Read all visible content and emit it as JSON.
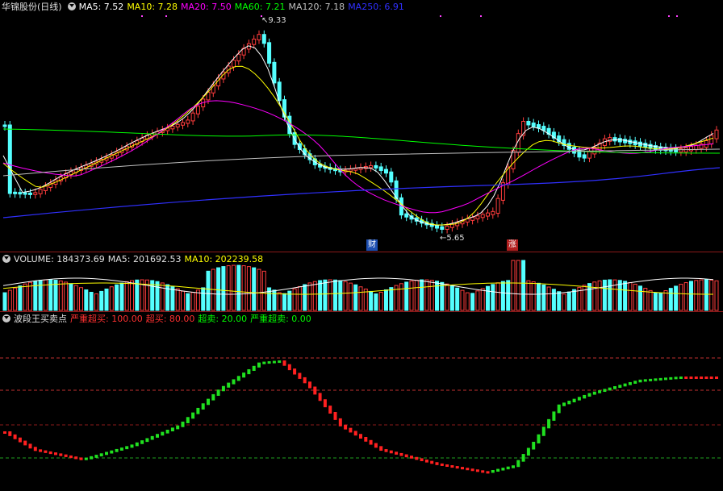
{
  "main": {
    "stock_name": "华锦股份(日线)",
    "ma": [
      {
        "label": "MA5: 7.52",
        "color": "#ffffff"
      },
      {
        "label": "MA10: 7.28",
        "color": "#ffff00"
      },
      {
        "label": "MA20: 7.50",
        "color": "#ff00ff"
      },
      {
        "label": "MA60: 7.21",
        "color": "#00ff00"
      },
      {
        "label": "MA120: 7.18",
        "color": "#c0c0c0"
      },
      {
        "label": "MA250: 6.91",
        "color": "#3030ff"
      }
    ],
    "high_label": "9.33",
    "low_label": "5.65",
    "tag_cai": "财",
    "tag_zhang": "涨"
  },
  "volume": {
    "title": "VOLUME: 184373.69",
    "ma5": "MA5: 201692.53",
    "ma10": "MA10: 202239.58"
  },
  "indicator": {
    "title": "波段王买卖点",
    "items": [
      {
        "label": "严重超买: 100.00",
        "color": "#ff3030"
      },
      {
        "label": "超买: 80.00",
        "color": "#ff3030"
      },
      {
        "label": "超卖: 20.00",
        "color": "#00ff00"
      },
      {
        "label": "严重超卖: 0.00",
        "color": "#00ff00"
      }
    ]
  },
  "colors": {
    "up": "#ff3c3c",
    "down": "#54ffff",
    "bg": "#000000",
    "grid": "#8b1a1a"
  }
}
